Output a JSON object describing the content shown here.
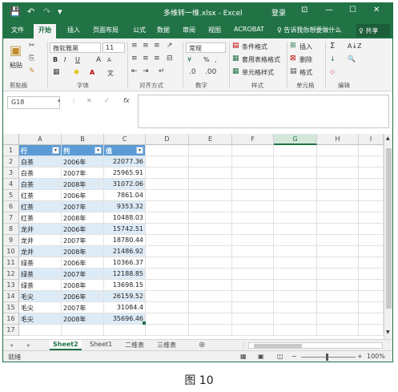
{
  "titlebar": {
    "title": "多维转一维.xlsx - Excel",
    "login": "登录",
    "minimize": "—",
    "restore": "☐",
    "close": "✕",
    "ribbon_display": "⊡",
    "save_icon": "💾",
    "undo_icon": "↶",
    "redo_icon": "↷",
    "customize_icon": "▾"
  },
  "tabs": [
    "文件",
    "开始",
    "插入",
    "页面布局",
    "公式",
    "数据",
    "审阅",
    "视图",
    "ACROBAT",
    "♀ 告诉我你想要做什么"
  ],
  "share": "♀ 共享",
  "ribbon": {
    "clipboard": {
      "paste": "粘贴",
      "label": "剪贴板"
    },
    "font": {
      "name": "微软雅黑",
      "size": "11",
      "bold": "B",
      "italic": "I",
      "underline": "U",
      "grow": "A",
      "shrink": "A",
      "label": "字体",
      "fontcolor": "A",
      "wen": "文"
    },
    "alignment": {
      "label": "对齐方式"
    },
    "number": {
      "format": "常规",
      "percent": "%",
      "comma": ",",
      "label": "数字",
      "currency": "¥"
    },
    "styles": {
      "conditional": "条件格式",
      "table": "套用表格格式",
      "cell": "单元格样式",
      "label": "样式"
    },
    "cells": {
      "insert": "插入",
      "delete": "删除",
      "format": "格式",
      "label": "单元格"
    },
    "editing": {
      "sum": "Σ",
      "sort": "A↓Z",
      "fill": "↓",
      "find": "🔍",
      "clear": "◇",
      "label": "编辑"
    }
  },
  "formula": {
    "namebox": "G18",
    "cancel": "✕",
    "enter": "✓",
    "fx": "fx",
    "value": ""
  },
  "columns": [
    "A",
    "B",
    "C",
    "D",
    "E",
    "F",
    "G",
    "H",
    "I"
  ],
  "selected_column": "G",
  "table": {
    "headers": [
      "行",
      "列",
      "值"
    ],
    "rows": [
      [
        "白茶",
        "2006年",
        "22077.36"
      ],
      [
        "白茶",
        "2007年",
        "25965.91"
      ],
      [
        "白茶",
        "2008年",
        "31072.06"
      ],
      [
        "红茶",
        "2006年",
        "7861.04"
      ],
      [
        "红茶",
        "2007年",
        "9353.32"
      ],
      [
        "红茶",
        "2008年",
        "10488.03"
      ],
      [
        "龙井",
        "2006年",
        "15742.51"
      ],
      [
        "龙井",
        "2007年",
        "18780.44"
      ],
      [
        "龙井",
        "2008年",
        "21486.92"
      ],
      [
        "绿茶",
        "2006年",
        "10366.37"
      ],
      [
        "绿茶",
        "2007年",
        "12188.85"
      ],
      [
        "绿茶",
        "2008年",
        "13698.15"
      ],
      [
        "毛尖",
        "2006年",
        "26159.52"
      ],
      [
        "毛尖",
        "2007年",
        "31084.4"
      ],
      [
        "毛尖",
        "2008年",
        "35696.46"
      ]
    ]
  },
  "row_numbers": [
    "1",
    "2",
    "3",
    "4",
    "5",
    "6",
    "7",
    "8",
    "9",
    "10",
    "11",
    "12",
    "13",
    "14",
    "15",
    "16",
    "17"
  ],
  "sheets": [
    "Sheet2",
    "Sheet1",
    "二维表",
    "三维表"
  ],
  "active_sheet": "Sheet2",
  "add_sheet": "⊕",
  "status": {
    "ready": "就绪",
    "zoom": "100%",
    "minus": "−",
    "plus": "+"
  },
  "caption": "图 10"
}
